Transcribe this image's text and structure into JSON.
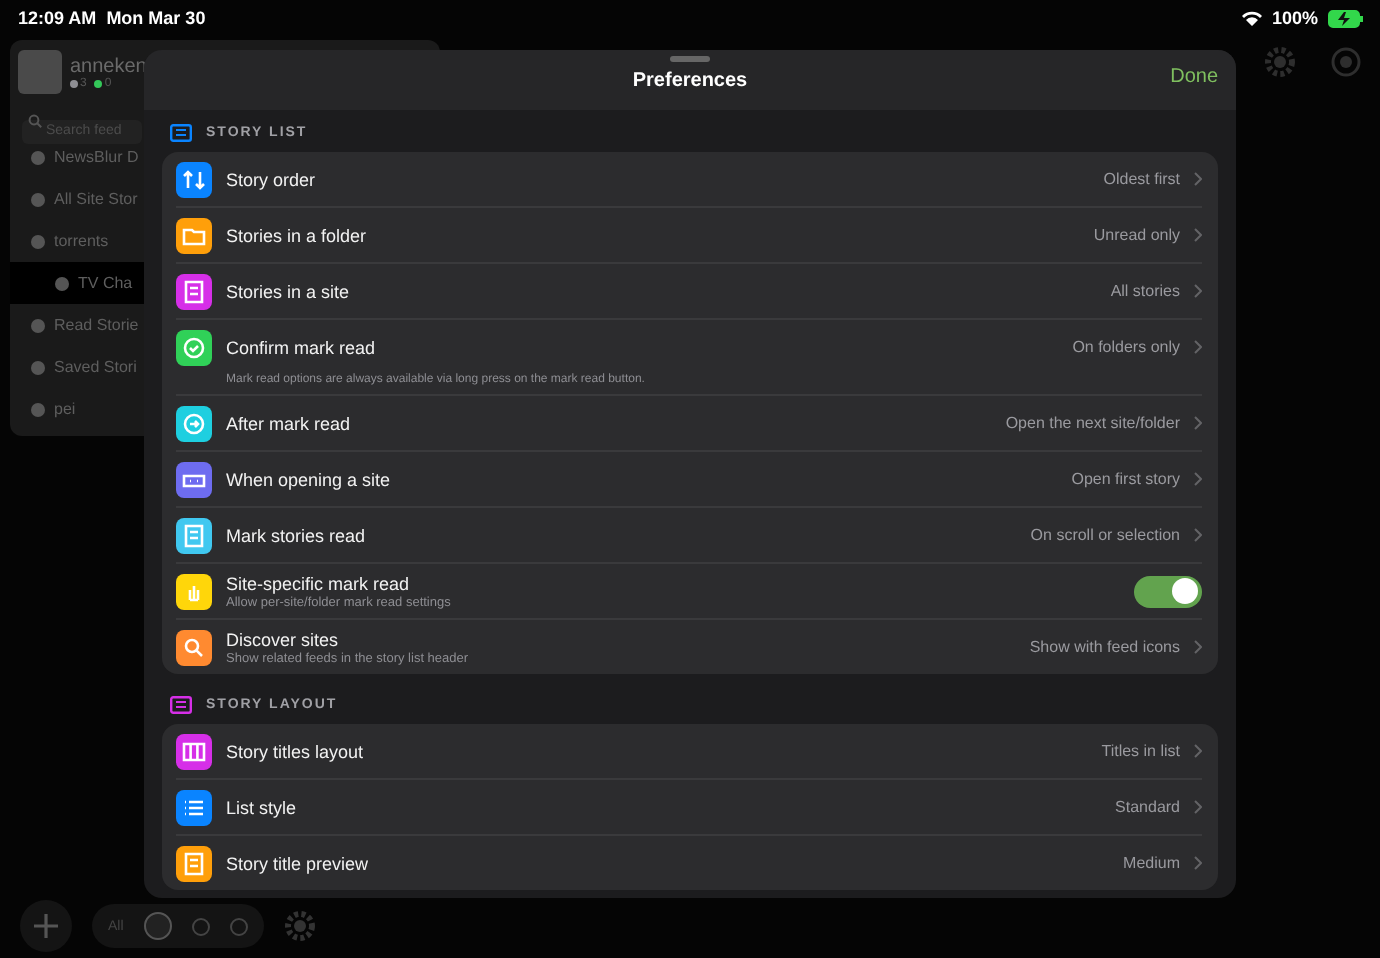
{
  "status_bar": {
    "time": "12:09 AM",
    "date": "Mon Mar 30",
    "battery": "100%"
  },
  "sidebar": {
    "user": "anneken",
    "counts": [
      {
        "value": "3",
        "color": "#8e8e93"
      },
      {
        "value": "0",
        "color": "#34c759"
      }
    ],
    "search": {
      "placeholder": "Search feed"
    },
    "items": [
      {
        "label": "NewsBlur D",
        "selected": false
      },
      {
        "label": "All Site Stor",
        "selected": false
      },
      {
        "label": "torrents",
        "selected": false,
        "children": [
          {
            "label": "TV Cha",
            "selected": true
          }
        ]
      },
      {
        "label": "Read Storie",
        "selected": false
      },
      {
        "label": "Saved Stori",
        "selected": false
      },
      {
        "label": "pei",
        "selected": false
      }
    ]
  },
  "bottom_bar": {
    "filter": "All"
  },
  "modal": {
    "title": "Preferences",
    "done": "Done",
    "sections": [
      {
        "title": "STORY LIST",
        "color": "#0a84ff",
        "rows": [
          {
            "kind": "select",
            "label": "Story order",
            "value": "Oldest first",
            "color": "#0a84ff"
          },
          {
            "kind": "select",
            "label": "Stories in a folder",
            "value": "Unread only",
            "color": "#ff9f0a"
          },
          {
            "kind": "select",
            "label": "Stories in a site",
            "value": "All stories",
            "color": "#d62fe8"
          },
          {
            "kind": "select",
            "label": "Confirm mark read",
            "value": "On folders only",
            "color": "#30d158",
            "note": "Mark read options are always available via long press on the mark read button."
          },
          {
            "kind": "select",
            "label": "After mark read",
            "value": "Open the next site/folder",
            "color": "#1ecfe0"
          },
          {
            "kind": "select",
            "label": "When opening a site",
            "value": "Open first story",
            "color": "#6e6cf0"
          },
          {
            "kind": "select",
            "label": "Mark stories read",
            "value": "On scroll or selection",
            "color": "#40c8f0"
          },
          {
            "kind": "toggle",
            "label": "Site-specific mark read",
            "subtitle": "Allow per-site/folder mark read settings",
            "on": true,
            "color": "#ffd60a"
          },
          {
            "kind": "select",
            "label": "Discover sites",
            "subtitle": "Show related feeds in the story list header",
            "value": "Show with feed icons",
            "color": "#ff8a30"
          }
        ]
      },
      {
        "title": "STORY LAYOUT",
        "color": "#d62fe8",
        "rows": [
          {
            "kind": "select",
            "label": "Story titles layout",
            "value": "Titles in list",
            "color": "#d62fe8"
          },
          {
            "kind": "select",
            "label": "List style",
            "value": "Standard",
            "color": "#0a84ff"
          },
          {
            "kind": "select",
            "label": "Story title preview",
            "value": "Medium",
            "color": "#ff9f0a"
          }
        ]
      }
    ]
  }
}
